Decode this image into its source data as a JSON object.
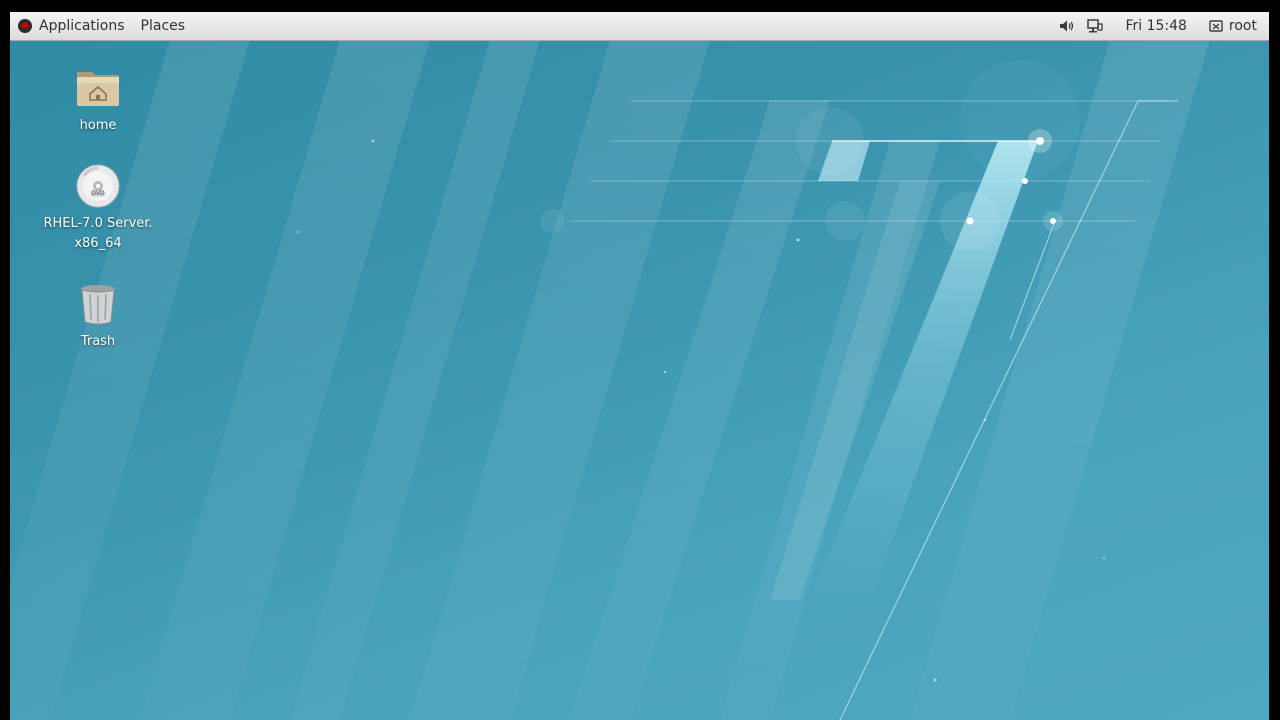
{
  "topbar": {
    "applications_label": "Applications",
    "places_label": "Places",
    "clock": "Fri 15:48",
    "user": "root",
    "icons": [
      "volume-icon",
      "network-icon",
      "power-icon"
    ]
  },
  "desktop": {
    "icons": [
      {
        "label": "home",
        "icon": "home-folder-icon"
      },
      {
        "label": "RHEL-7.0 Server.\nx86_64",
        "icon": "dvd-icon"
      },
      {
        "label": "Trash",
        "icon": "trash-icon"
      }
    ]
  },
  "colors": {
    "wallpaper": "#3a93ad",
    "panel": "#e8e8e8",
    "redhat": "#cc0000"
  }
}
